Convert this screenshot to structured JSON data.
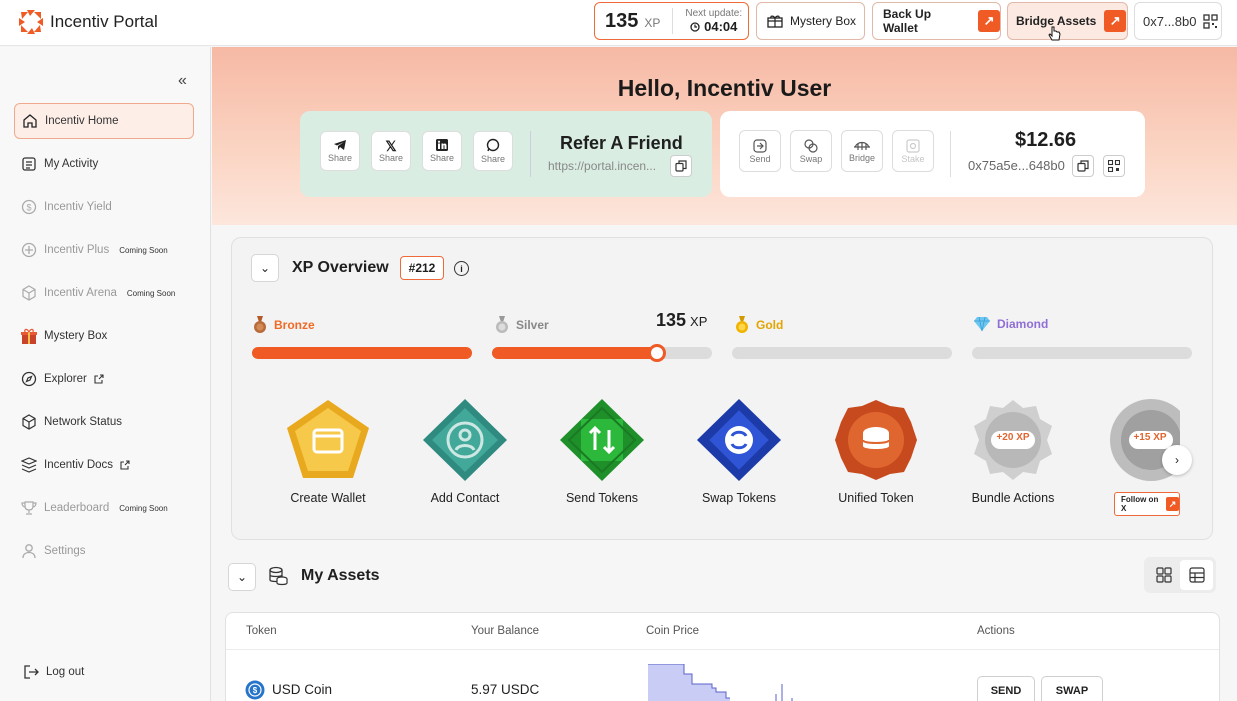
{
  "app": {
    "title": "Incentiv Portal"
  },
  "topbar": {
    "xp_value": "135",
    "xp_unit": "XP",
    "next_update_label": "Next update:",
    "next_update_time": "04:04",
    "mystery_box": "Mystery Box",
    "backup_wallet": "Back Up Wallet",
    "bridge_assets": "Bridge Assets",
    "wallet_address": "0x7...8b0"
  },
  "sidebar": {
    "items": [
      {
        "label": "Incentiv Home",
        "icon": "home-icon",
        "active": true
      },
      {
        "label": "My Activity",
        "icon": "activity-icon"
      },
      {
        "label": "Incentiv Yield",
        "icon": "dollar-icon",
        "dim": true
      },
      {
        "label": "Incentiv Plus",
        "icon": "plus-circle-icon",
        "dim": true,
        "badge": "Coming Soon"
      },
      {
        "label": "Incentiv Arena",
        "icon": "cube-icon",
        "dim": true,
        "badge": "Coming Soon"
      },
      {
        "label": "Mystery Box",
        "icon": "gift-icon"
      },
      {
        "label": "Explorer",
        "icon": "compass-icon",
        "external": true
      },
      {
        "label": "Network Status",
        "icon": "box-icon"
      },
      {
        "label": "Incentiv Docs",
        "icon": "docs-icon",
        "external": true
      },
      {
        "label": "Leaderboard",
        "icon": "trophy-icon",
        "dim": true,
        "badge": "Coming Soon"
      },
      {
        "label": "Settings",
        "icon": "user-icon",
        "dim": true
      }
    ],
    "logout": "Log out"
  },
  "hero": {
    "greeting": "Hello, Incentiv User",
    "share_buttons": [
      {
        "icon": "telegram-icon",
        "label": "Share"
      },
      {
        "icon": "x-icon",
        "label": "Share"
      },
      {
        "icon": "linkedin-icon",
        "label": "Share"
      },
      {
        "icon": "whatsapp-icon",
        "label": "Share"
      }
    ],
    "refer_title": "Refer A Friend",
    "refer_link": "https://portal.incen...",
    "wallet_actions": [
      {
        "label": "Send"
      },
      {
        "label": "Swap"
      },
      {
        "label": "Bridge"
      },
      {
        "label": "Stake",
        "disabled": true
      }
    ],
    "balance": "$12.66",
    "address": "0x75a5e...648b0"
  },
  "xp_overview": {
    "title": "XP Overview",
    "rank": "#212",
    "current_xp": "135",
    "xp_unit": "XP",
    "tiers": [
      {
        "name": "Bronze",
        "color": "#ef6a25",
        "progress": 1.0
      },
      {
        "name": "Silver",
        "color": "#999999",
        "progress": 0.75
      },
      {
        "name": "Gold",
        "color": "#e3a400",
        "progress": 0
      },
      {
        "name": "Diamond",
        "color": "#8f6fd6",
        "progress": 0
      }
    ],
    "badges": [
      {
        "label": "Create Wallet"
      },
      {
        "label": "Add Contact"
      },
      {
        "label": "Send Tokens"
      },
      {
        "label": "Swap Tokens"
      },
      {
        "label": "Unified Token"
      },
      {
        "label": "Bundle Actions",
        "xp": "+20 XP"
      },
      {
        "label": "",
        "xp": "+15 XP"
      }
    ],
    "follow_label": "Follow on X"
  },
  "assets": {
    "title": "My Assets",
    "columns": [
      "Token",
      "Your Balance",
      "Coin Price",
      "Actions"
    ],
    "rows": [
      {
        "token": "USD Coin",
        "balance": "5.97 USDC",
        "actions": [
          "SEND",
          "SWAP"
        ]
      }
    ]
  }
}
